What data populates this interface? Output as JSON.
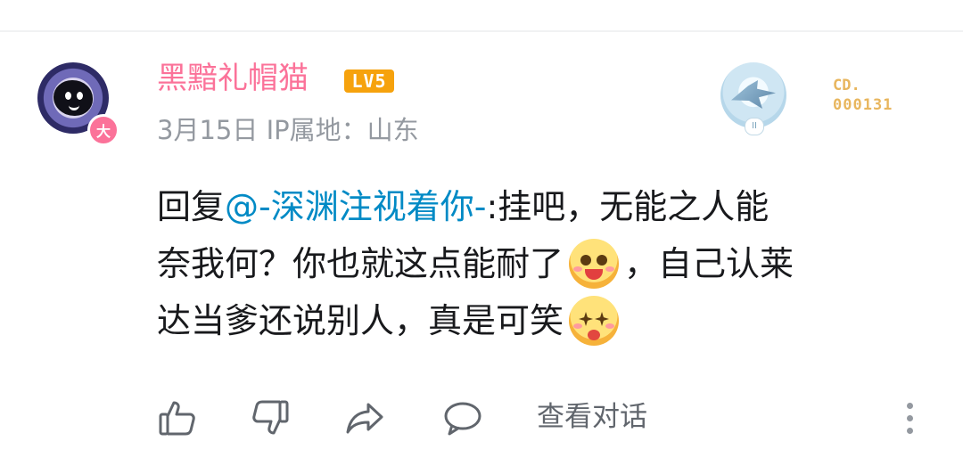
{
  "comment": {
    "user": {
      "name": "黑黯礼帽猫",
      "level": "LV5",
      "avatar_badge": "大",
      "avatar_icon": "avatar-cat-icon"
    },
    "meta": "3月15日 IP属地：山东",
    "fan_medal": {
      "label": "CD.",
      "number": "000131",
      "medal_level": "II"
    },
    "content": {
      "reply_prefix": "回复 ",
      "mention": "@-深渊注视着你-",
      "line1_rest": " :挂吧，无能之人能",
      "line2_text": "奈我何？你也就这点能耐了",
      "line2_after": "，自己认莱",
      "line3_text": "达当爹还说别人，真是可笑",
      "emoji1": "watermelon-emoji",
      "emoji2": "star-eyes-emoji"
    },
    "actions": {
      "like_icon": "thumb-up-icon",
      "dislike_icon": "thumb-down-icon",
      "share_icon": "share-icon",
      "comment_icon": "comment-icon",
      "view_dialog": "查看对话",
      "more_icon": "more-vertical-icon"
    }
  },
  "colors": {
    "username": "#fb7299",
    "level_badge": "#f6a20d",
    "meta_text": "#9499a0",
    "mention": "#008ac5",
    "medal_text": "#e8b65e"
  }
}
